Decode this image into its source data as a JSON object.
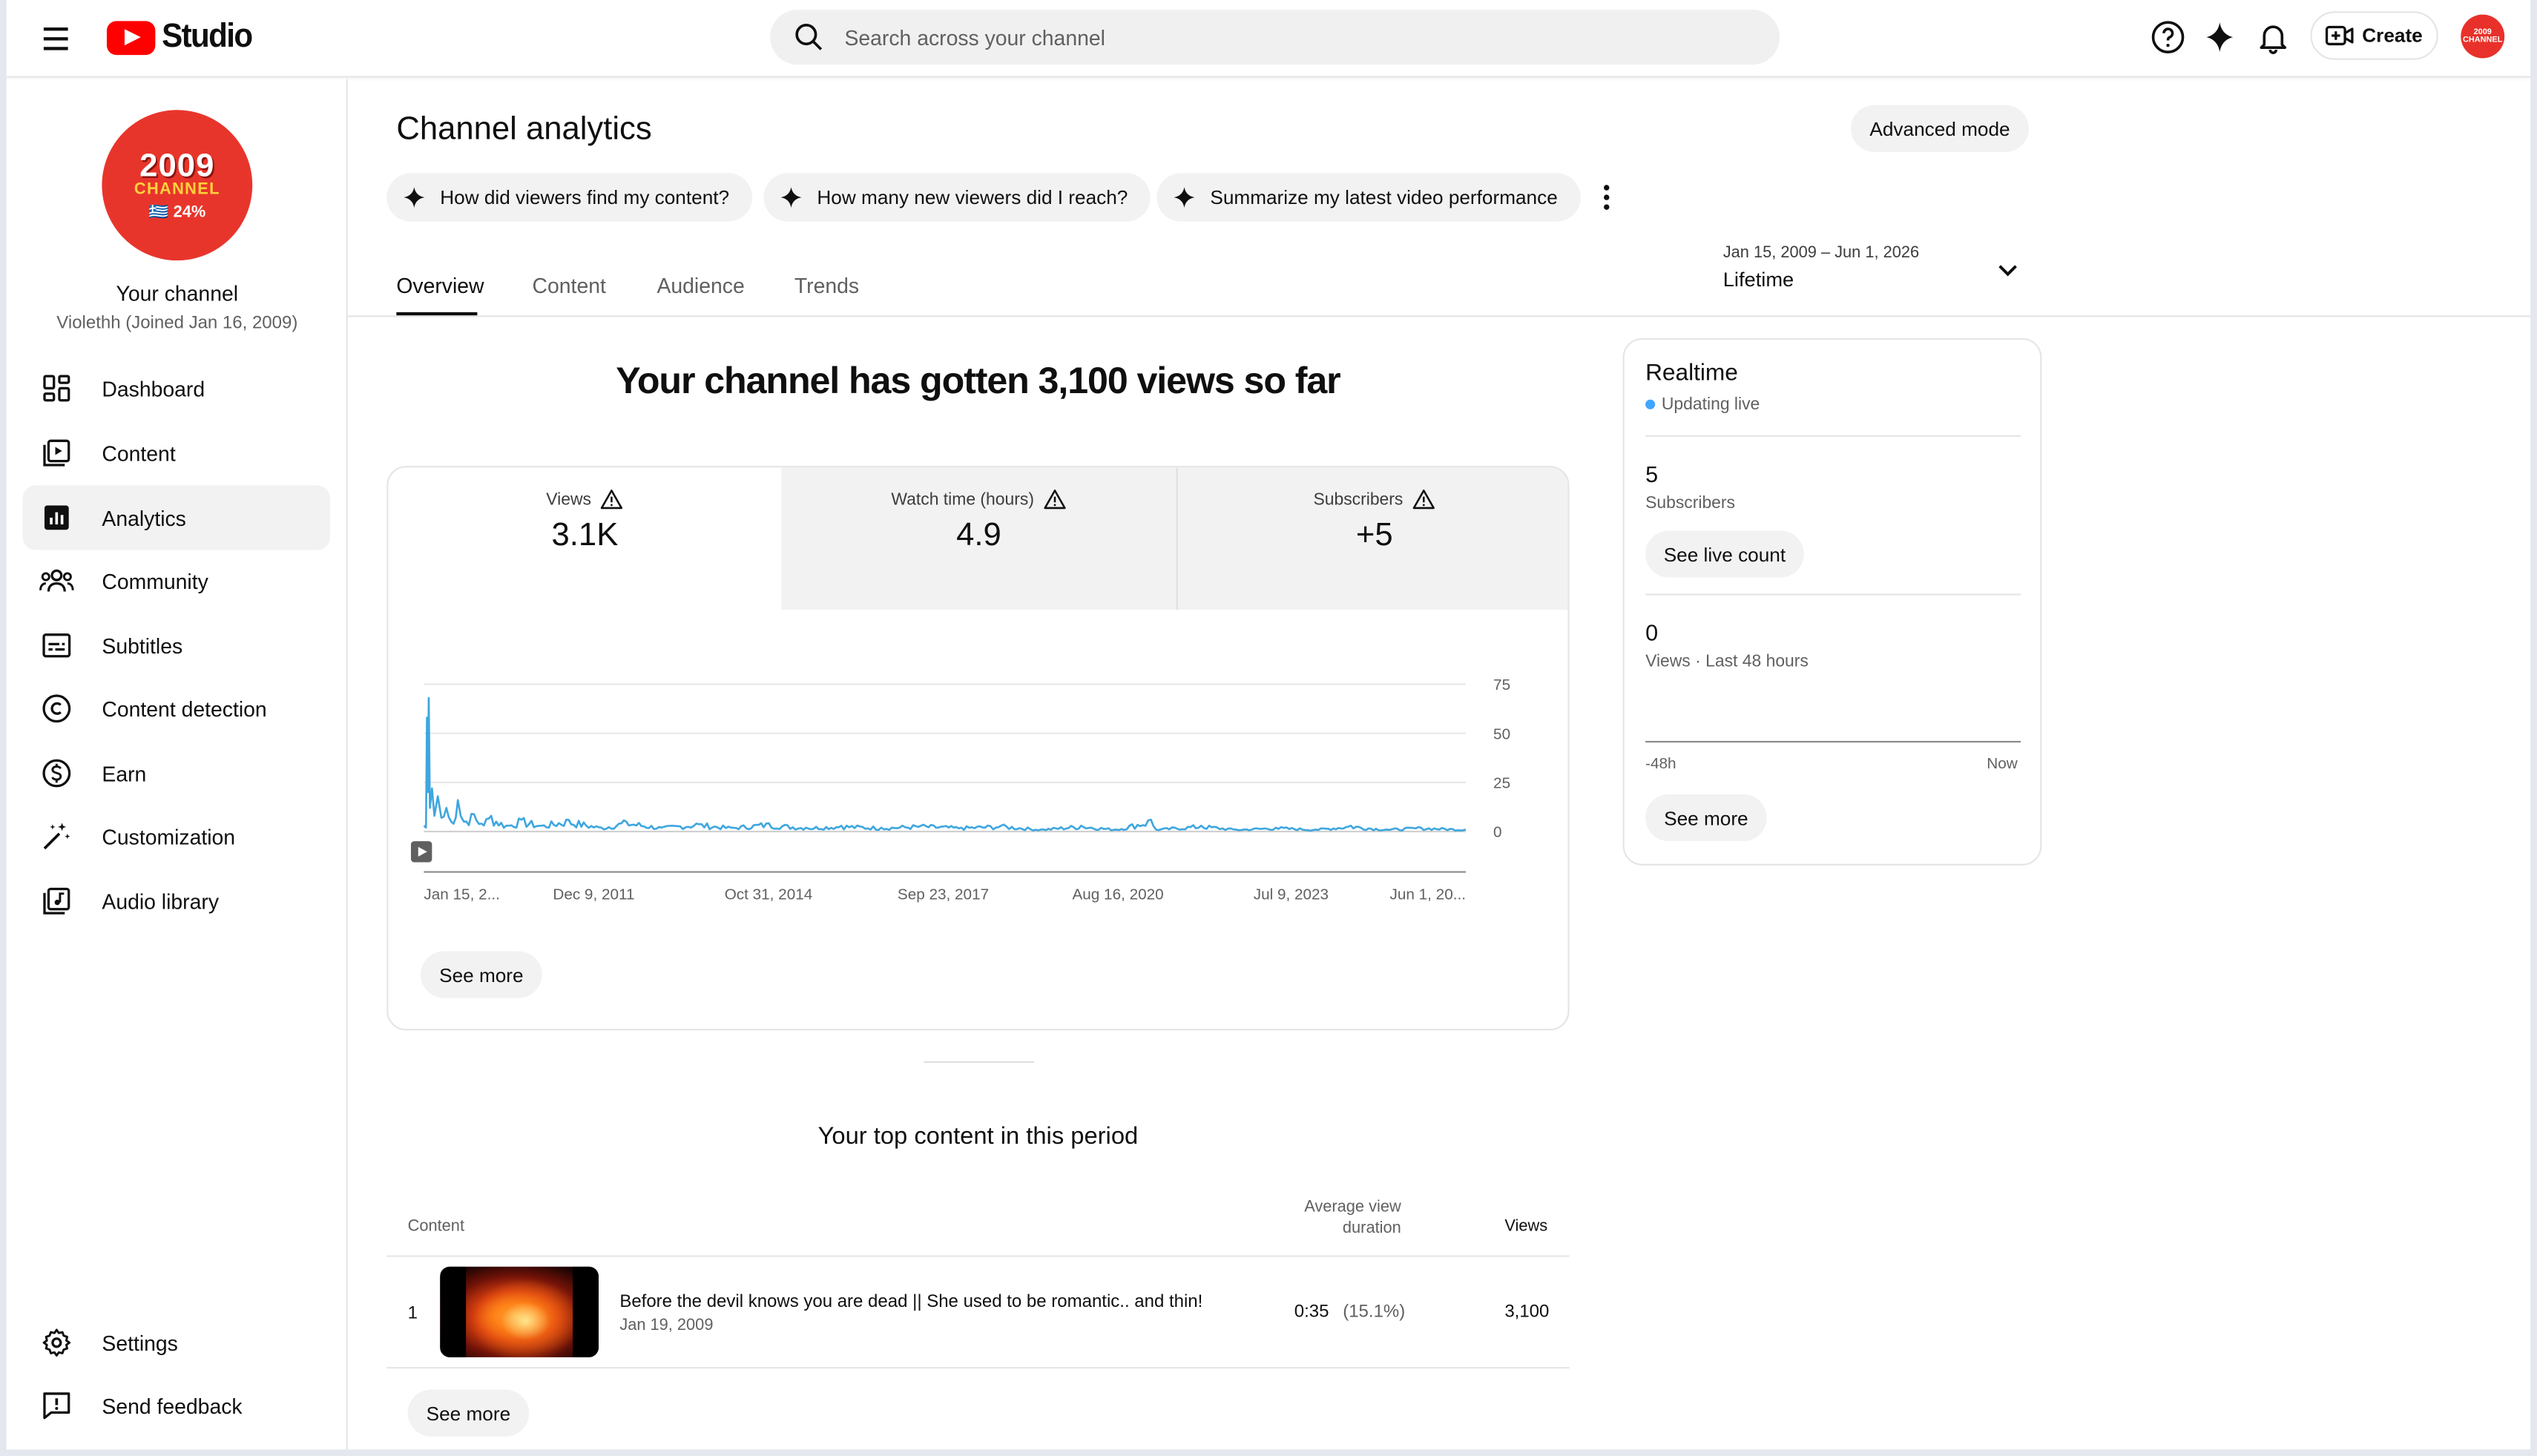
{
  "header": {
    "logo_text": "Studio",
    "search_placeholder": "Search across your channel",
    "create_label": "Create",
    "avatar_text": "2009 CHANNEL"
  },
  "sidebar": {
    "avatar": {
      "line1": "2009",
      "line2": "CHANNEL",
      "line3": "🇬🇷 24%"
    },
    "channel_name": "Your channel",
    "channel_sub": "Violethh (Joined Jan 16, 2009)",
    "items": [
      {
        "label": "Dashboard",
        "icon": "dashboard-icon"
      },
      {
        "label": "Content",
        "icon": "content-icon"
      },
      {
        "label": "Analytics",
        "icon": "analytics-icon",
        "active": true
      },
      {
        "label": "Community",
        "icon": "community-icon"
      },
      {
        "label": "Subtitles",
        "icon": "subtitles-icon"
      },
      {
        "label": "Content detection",
        "icon": "copyright-icon"
      },
      {
        "label": "Earn",
        "icon": "dollar-icon"
      },
      {
        "label": "Customization",
        "icon": "magic-wand-icon"
      },
      {
        "label": "Audio library",
        "icon": "audio-library-icon"
      }
    ],
    "bottom_items": [
      {
        "label": "Settings",
        "icon": "gear-icon"
      },
      {
        "label": "Send feedback",
        "icon": "feedback-icon"
      }
    ]
  },
  "main": {
    "title": "Channel analytics",
    "advanced_mode": "Advanced mode",
    "chips": [
      "How did viewers find my content?",
      "How many new viewers did I reach?",
      "Summarize my latest video performance"
    ],
    "tabs": [
      "Overview",
      "Content",
      "Audience",
      "Trends"
    ],
    "active_tab": "Overview",
    "date_range": {
      "range": "Jan 15, 2009 – Jun 1, 2026",
      "label": "Lifetime"
    },
    "headline": "Your channel has gotten 3,100 views so far",
    "metrics": [
      {
        "label": "Views",
        "value": "3.1K"
      },
      {
        "label": "Watch time (hours)",
        "value": "4.9"
      },
      {
        "label": "Subscribers",
        "value": "+5"
      }
    ],
    "see_more": "See more",
    "top_content": {
      "title": "Your top content in this period",
      "col_content": "Content",
      "col_avg": "Average view duration",
      "col_avg_line1": "Average view",
      "col_avg_line2": "duration",
      "col_views": "Views",
      "rows": [
        {
          "rank": "1",
          "title": "Before the devil knows you are dead || She used to be romantic.. and thin!",
          "date": "Jan 19, 2009",
          "avg": "0:35",
          "pct": "(15.1%)",
          "views": "3,100"
        }
      ]
    }
  },
  "realtime": {
    "title": "Realtime",
    "live": "Updating live",
    "subs_value": "5",
    "subs_label": "Subscribers",
    "see_live": "See live count",
    "views_value": "0",
    "views_label": "Views · Last 48 hours",
    "tick_left": "-48h",
    "tick_right": "Now",
    "see_more": "See more"
  },
  "chart_data": {
    "type": "line",
    "title": "",
    "xlabel": "",
    "ylabel": "",
    "x_ticks": [
      "Jan 15, 2...",
      "Dec 9, 2011",
      "Oct 31, 2014",
      "Sep 23, 2017",
      "Aug 16, 2020",
      "Jul 9, 2023",
      "Jun 1, 20..."
    ],
    "y_ticks": [
      0,
      25,
      50,
      75
    ],
    "ylim": [
      0,
      75
    ],
    "xlim": [
      "2009-01-15",
      "2026-06-01"
    ],
    "grid": true,
    "color": "#3ea6df",
    "series": [
      {
        "points": [
          [
            "2009-01-15",
            3
          ],
          [
            "2009-01-28",
            2
          ],
          [
            "2009-02-03",
            58
          ],
          [
            "2009-02-08",
            20
          ],
          [
            "2009-02-14",
            68
          ],
          [
            "2009-02-20",
            12
          ],
          [
            "2009-03-05",
            22
          ],
          [
            "2009-03-20",
            8
          ],
          [
            "2009-04-10",
            18
          ],
          [
            "2009-05-01",
            7
          ],
          [
            "2009-06-01",
            12
          ],
          [
            "2009-07-01",
            5
          ],
          [
            "2009-08-10",
            16
          ],
          [
            "2009-09-15",
            5
          ],
          [
            "2009-11-01",
            9
          ],
          [
            "2010-01-01",
            4
          ],
          [
            "2010-03-01",
            8
          ],
          [
            "2010-06-01",
            3
          ],
          [
            "2010-09-01",
            6
          ],
          [
            "2011-01-01",
            3
          ],
          [
            "2011-06-01",
            6
          ],
          [
            "2012-01-01",
            2
          ],
          [
            "2012-06-01",
            5
          ],
          [
            "2013-01-01",
            2
          ],
          [
            "2013-08-01",
            4
          ],
          [
            "2014-03-01",
            2
          ],
          [
            "2014-10-01",
            4
          ],
          [
            "2015-06-01",
            2
          ],
          [
            "2016-01-01",
            3
          ],
          [
            "2016-09-01",
            2
          ],
          [
            "2017-05-01",
            3
          ],
          [
            "2018-01-01",
            2
          ],
          [
            "2018-09-01",
            3
          ],
          [
            "2019-05-01",
            1
          ],
          [
            "2020-01-01",
            3
          ],
          [
            "2020-08-01",
            1
          ],
          [
            "2021-03-01",
            6
          ],
          [
            "2021-04-01",
            1
          ],
          [
            "2022-01-01",
            3
          ],
          [
            "2022-08-01",
            1
          ],
          [
            "2023-04-01",
            2
          ],
          [
            "2023-12-01",
            1
          ],
          [
            "2024-07-01",
            3
          ],
          [
            "2025-02-01",
            1
          ],
          [
            "2025-09-01",
            2
          ],
          [
            "2026-06-01",
            1
          ]
        ]
      }
    ]
  }
}
